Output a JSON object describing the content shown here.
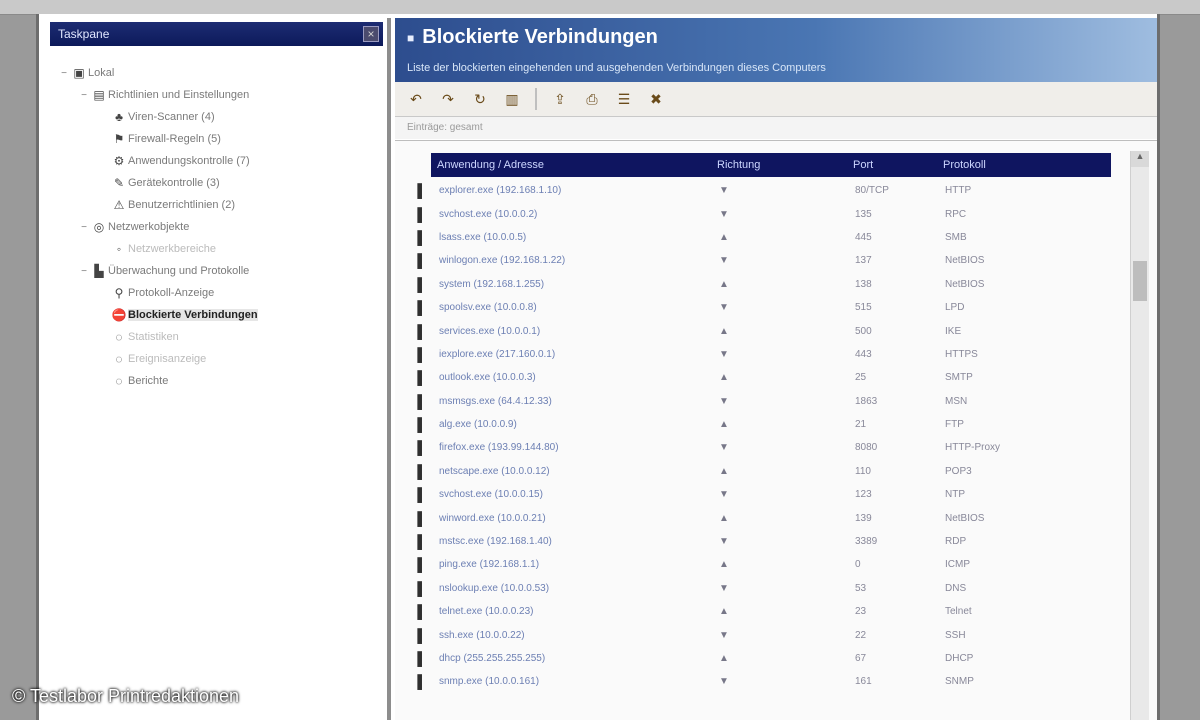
{
  "window": {
    "left_panel_title": "Taskpane",
    "close_glyph": "×"
  },
  "tree": [
    {
      "id": "root",
      "label": "Lokal",
      "level": 0,
      "icon": "computer-icon",
      "glyph": "▣",
      "expander": "−"
    },
    {
      "id": "policy",
      "label": "Richtlinien und Einstellungen",
      "level": 1,
      "icon": "folder-icon",
      "glyph": "▤",
      "expander": "−"
    },
    {
      "id": "p1",
      "label": "Viren-Scanner (4)",
      "level": 2,
      "icon": "shield-icon",
      "glyph": "♣"
    },
    {
      "id": "p2",
      "label": "Firewall-Regeln (5)",
      "level": 2,
      "icon": "rule-icon",
      "glyph": "⚑"
    },
    {
      "id": "p3",
      "label": "Anwendungskontrolle (7)",
      "level": 2,
      "icon": "app-icon",
      "glyph": "⚙"
    },
    {
      "id": "p4",
      "label": "Gerätekontrolle (3)",
      "level": 2,
      "icon": "device-icon",
      "glyph": "✎"
    },
    {
      "id": "p5",
      "label": "Benutzerrichtlinien (2)",
      "level": 2,
      "icon": "user-icon",
      "glyph": "⚠"
    },
    {
      "id": "net",
      "label": "Netzwerkobjekte",
      "level": 1,
      "icon": "network-icon",
      "glyph": "◎",
      "expander": "−"
    },
    {
      "id": "n1",
      "label": "Netzwerkbereiche",
      "level": 2,
      "icon": "network-range-icon",
      "glyph": "◦",
      "dim": true
    },
    {
      "id": "mon",
      "label": "Überwachung und Protokolle",
      "level": 1,
      "icon": "log-icon",
      "glyph": "▙",
      "expander": "−"
    },
    {
      "id": "m1",
      "label": "Protokoll-Anzeige",
      "level": 2,
      "icon": "log-view-icon",
      "glyph": "⚲"
    },
    {
      "id": "m2",
      "label": "Blockierte Verbindungen",
      "level": 2,
      "icon": "block-icon",
      "glyph": "⛔",
      "selected": true
    },
    {
      "id": "m3",
      "label": "Statistiken",
      "level": 2,
      "icon": "stats-icon",
      "glyph": "◌",
      "dim": true
    },
    {
      "id": "m4",
      "label": "Ereignisanzeige",
      "level": 2,
      "icon": "event-icon",
      "glyph": "◌",
      "dim": true
    },
    {
      "id": "m5",
      "label": "Berichte",
      "level": 2,
      "icon": "report-icon",
      "glyph": "◌"
    }
  ],
  "banner": {
    "title": "Blockierte Verbindungen",
    "subtitle": "Liste der blockierten eingehenden und ausgehenden Verbindungen dieses Computers"
  },
  "toolbar": {
    "buttons": [
      {
        "name": "back-icon",
        "glyph": "↶"
      },
      {
        "name": "forward-icon",
        "glyph": "↷"
      },
      {
        "name": "refresh-icon",
        "glyph": "↻"
      },
      {
        "name": "filter-icon",
        "glyph": "▥"
      },
      {
        "name": "export-icon",
        "glyph": "⇪"
      },
      {
        "name": "print-icon",
        "glyph": "⎙"
      },
      {
        "name": "properties-icon",
        "glyph": "☰"
      },
      {
        "name": "delete-icon",
        "glyph": "✖"
      }
    ]
  },
  "subheader": "Einträge: gesamt",
  "table": {
    "headers": [
      "Anwendung / Adresse",
      "Richtung",
      "Port",
      "Protokoll"
    ],
    "rows": [
      [
        "explorer.exe (192.168.1.10)",
        "▼",
        "80/TCP",
        "HTTP"
      ],
      [
        "svchost.exe (10.0.0.2)",
        "▼",
        "135",
        "RPC"
      ],
      [
        "lsass.exe (10.0.0.5)",
        "▲",
        "445",
        "SMB"
      ],
      [
        "winlogon.exe (192.168.1.22)",
        "▼",
        "137",
        "NetBIOS"
      ],
      [
        "system (192.168.1.255)",
        "▲",
        "138",
        "NetBIOS"
      ],
      [
        "spoolsv.exe (10.0.0.8)",
        "▼",
        "515",
        "LPD"
      ],
      [
        "services.exe (10.0.0.1)",
        "▲",
        "500",
        "IKE"
      ],
      [
        "iexplore.exe (217.160.0.1)",
        "▼",
        "443",
        "HTTPS"
      ],
      [
        "outlook.exe (10.0.0.3)",
        "▲",
        "25",
        "SMTP"
      ],
      [
        "msmsgs.exe (64.4.12.33)",
        "▼",
        "1863",
        "MSN"
      ],
      [
        "alg.exe (10.0.0.9)",
        "▲",
        "21",
        "FTP"
      ],
      [
        "firefox.exe (193.99.144.80)",
        "▼",
        "8080",
        "HTTP-Proxy"
      ],
      [
        "netscape.exe (10.0.0.12)",
        "▲",
        "110",
        "POP3"
      ],
      [
        "svchost.exe (10.0.0.15)",
        "▼",
        "123",
        "NTP"
      ],
      [
        "winword.exe (10.0.0.21)",
        "▲",
        "139",
        "NetBIOS"
      ],
      [
        "mstsc.exe (192.168.1.40)",
        "▼",
        "3389",
        "RDP"
      ],
      [
        "ping.exe (192.168.1.1)",
        "▲",
        "0",
        "ICMP"
      ],
      [
        "nslookup.exe (10.0.0.53)",
        "▼",
        "53",
        "DNS"
      ],
      [
        "telnet.exe (10.0.0.23)",
        "▲",
        "23",
        "Telnet"
      ],
      [
        "ssh.exe (10.0.0.22)",
        "▼",
        "22",
        "SSH"
      ],
      [
        "dhcp (255.255.255.255)",
        "▲",
        "67",
        "DHCP"
      ],
      [
        "snmp.exe (10.0.0.161)",
        "▼",
        "161",
        "SNMP"
      ]
    ]
  },
  "watermark": "© Testlabor Printredaktionen",
  "colors": {
    "header_navy": "#0f1560",
    "banner_start": "#2d4d8e",
    "banner_end": "#9fbde0"
  }
}
